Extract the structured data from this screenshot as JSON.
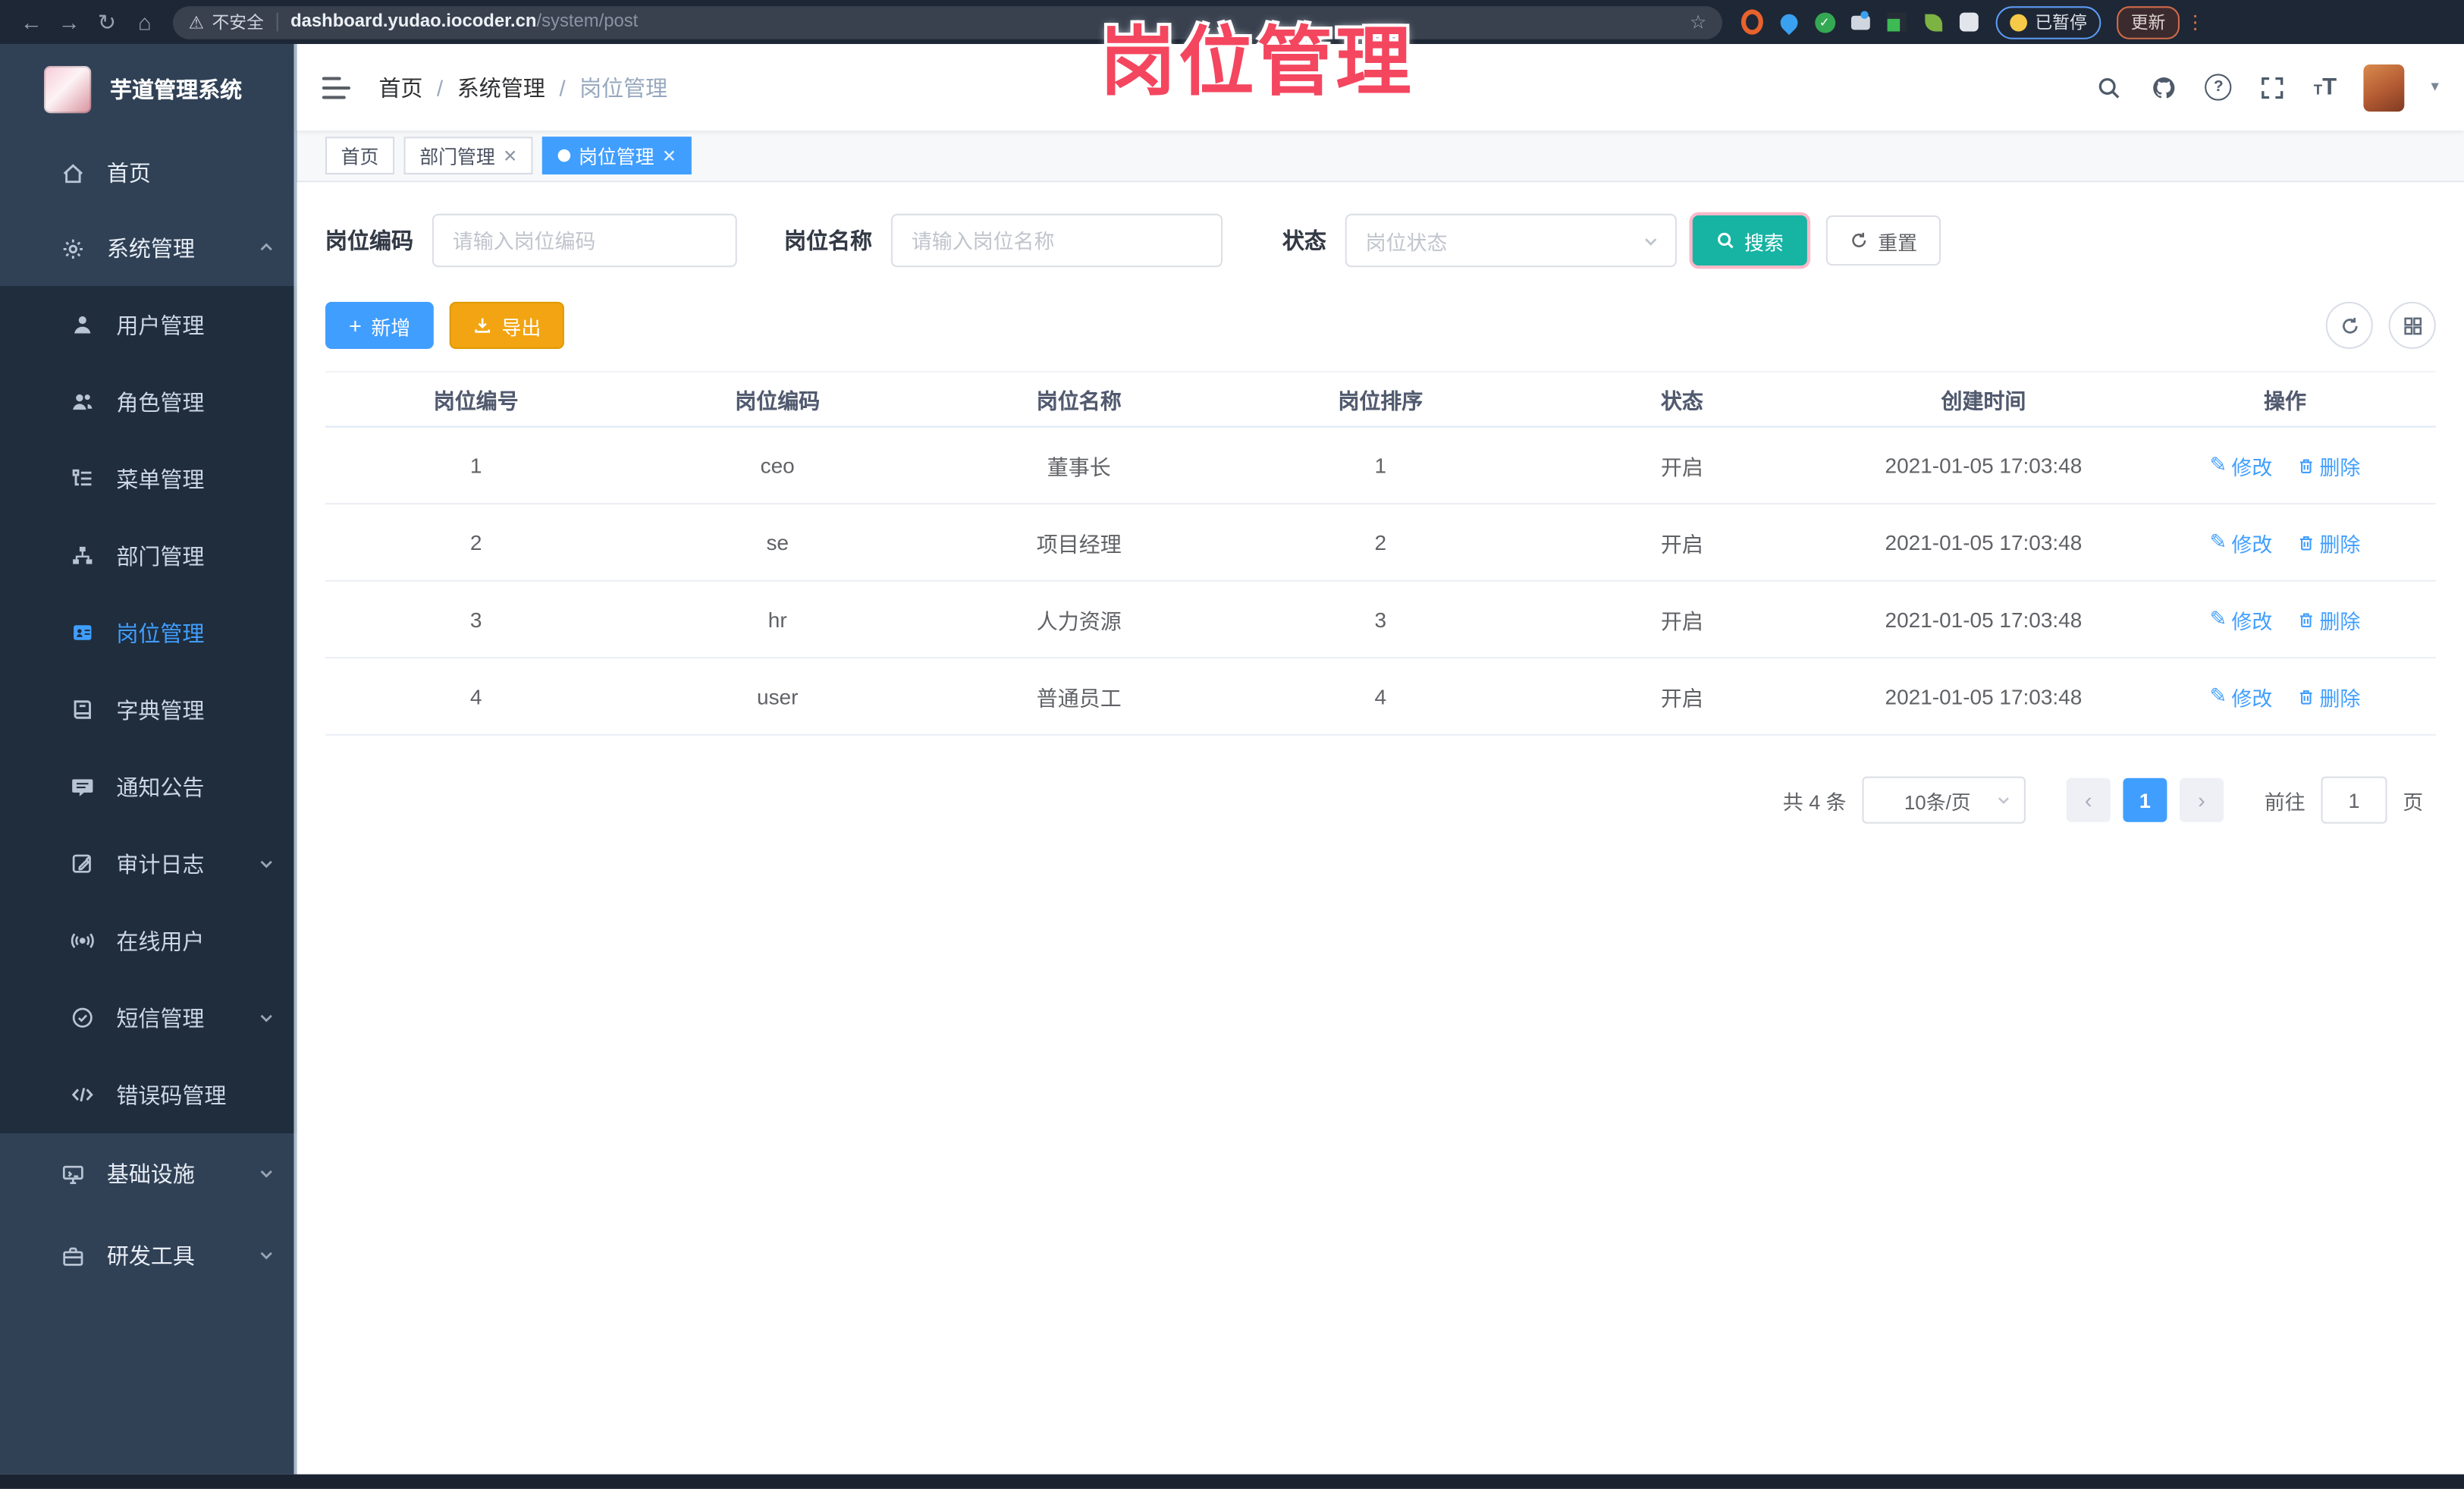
{
  "overlay": {
    "text": "岗位管理",
    "color": "#f4465f"
  },
  "browser": {
    "security_label": "不安全",
    "url_host": "dashboard.yudao.iocoder.cn",
    "url_path": "/system/post",
    "paused_badge": "已暂停",
    "update_button": "更新"
  },
  "sidebar": {
    "app_title": "芋道管理系统",
    "items": [
      {
        "label": "首页",
        "icon": "home-icon"
      },
      {
        "label": "系统管理",
        "icon": "gear-icon"
      },
      {
        "label": "用户管理",
        "icon": "user-icon"
      },
      {
        "label": "角色管理",
        "icon": "users-icon"
      },
      {
        "label": "菜单管理",
        "icon": "menu-list-icon"
      },
      {
        "label": "部门管理",
        "icon": "org-tree-icon"
      },
      {
        "label": "岗位管理",
        "icon": "badge-icon"
      },
      {
        "label": "字典管理",
        "icon": "book-icon"
      },
      {
        "label": "通知公告",
        "icon": "megaphone-icon"
      },
      {
        "label": "审计日志",
        "icon": "log-icon"
      },
      {
        "label": "在线用户",
        "icon": "online-icon"
      },
      {
        "label": "短信管理",
        "icon": "sms-icon"
      },
      {
        "label": "错误码管理",
        "icon": "code-icon"
      },
      {
        "label": "基础设施",
        "icon": "infra-icon"
      },
      {
        "label": "研发工具",
        "icon": "tools-icon"
      }
    ]
  },
  "header": {
    "breadcrumb": [
      "首页",
      "系统管理",
      "岗位管理"
    ]
  },
  "tabs": [
    {
      "label": "首页"
    },
    {
      "label": "部门管理"
    },
    {
      "label": "岗位管理"
    }
  ],
  "filters": {
    "code_label": "岗位编码",
    "code_placeholder": "请输入岗位编码",
    "name_label": "岗位名称",
    "name_placeholder": "请输入岗位名称",
    "status_label": "状态",
    "status_placeholder": "岗位状态",
    "search_label": "搜索",
    "reset_label": "重置"
  },
  "toolbar": {
    "add_label": "新增",
    "export_label": "导出"
  },
  "table": {
    "columns": [
      "岗位编号",
      "岗位编码",
      "岗位名称",
      "岗位排序",
      "状态",
      "创建时间",
      "操作"
    ],
    "edit_label": "修改",
    "delete_label": "删除",
    "rows": [
      {
        "id": "1",
        "code": "ceo",
        "name": "董事长",
        "sort": "1",
        "status": "开启",
        "created": "2021-01-05 17:03:48"
      },
      {
        "id": "2",
        "code": "se",
        "name": "项目经理",
        "sort": "2",
        "status": "开启",
        "created": "2021-01-05 17:03:48"
      },
      {
        "id": "3",
        "code": "hr",
        "name": "人力资源",
        "sort": "3",
        "status": "开启",
        "created": "2021-01-05 17:03:48"
      },
      {
        "id": "4",
        "code": "user",
        "name": "普通员工",
        "sort": "4",
        "status": "开启",
        "created": "2021-01-05 17:03:48"
      }
    ]
  },
  "pagination": {
    "total_text": "共 4 条",
    "page_size": "10条/页",
    "current_page": "1",
    "goto_label": "前往",
    "goto_value": "1",
    "unit_label": "页"
  },
  "colors": {
    "accent": "#409eff",
    "search_button": "#17b3a3",
    "export_button": "#f2a412",
    "sidebar_bg": "#304156",
    "submenu_bg": "#1f2d3d",
    "overlay_pink": "#f4465f"
  }
}
